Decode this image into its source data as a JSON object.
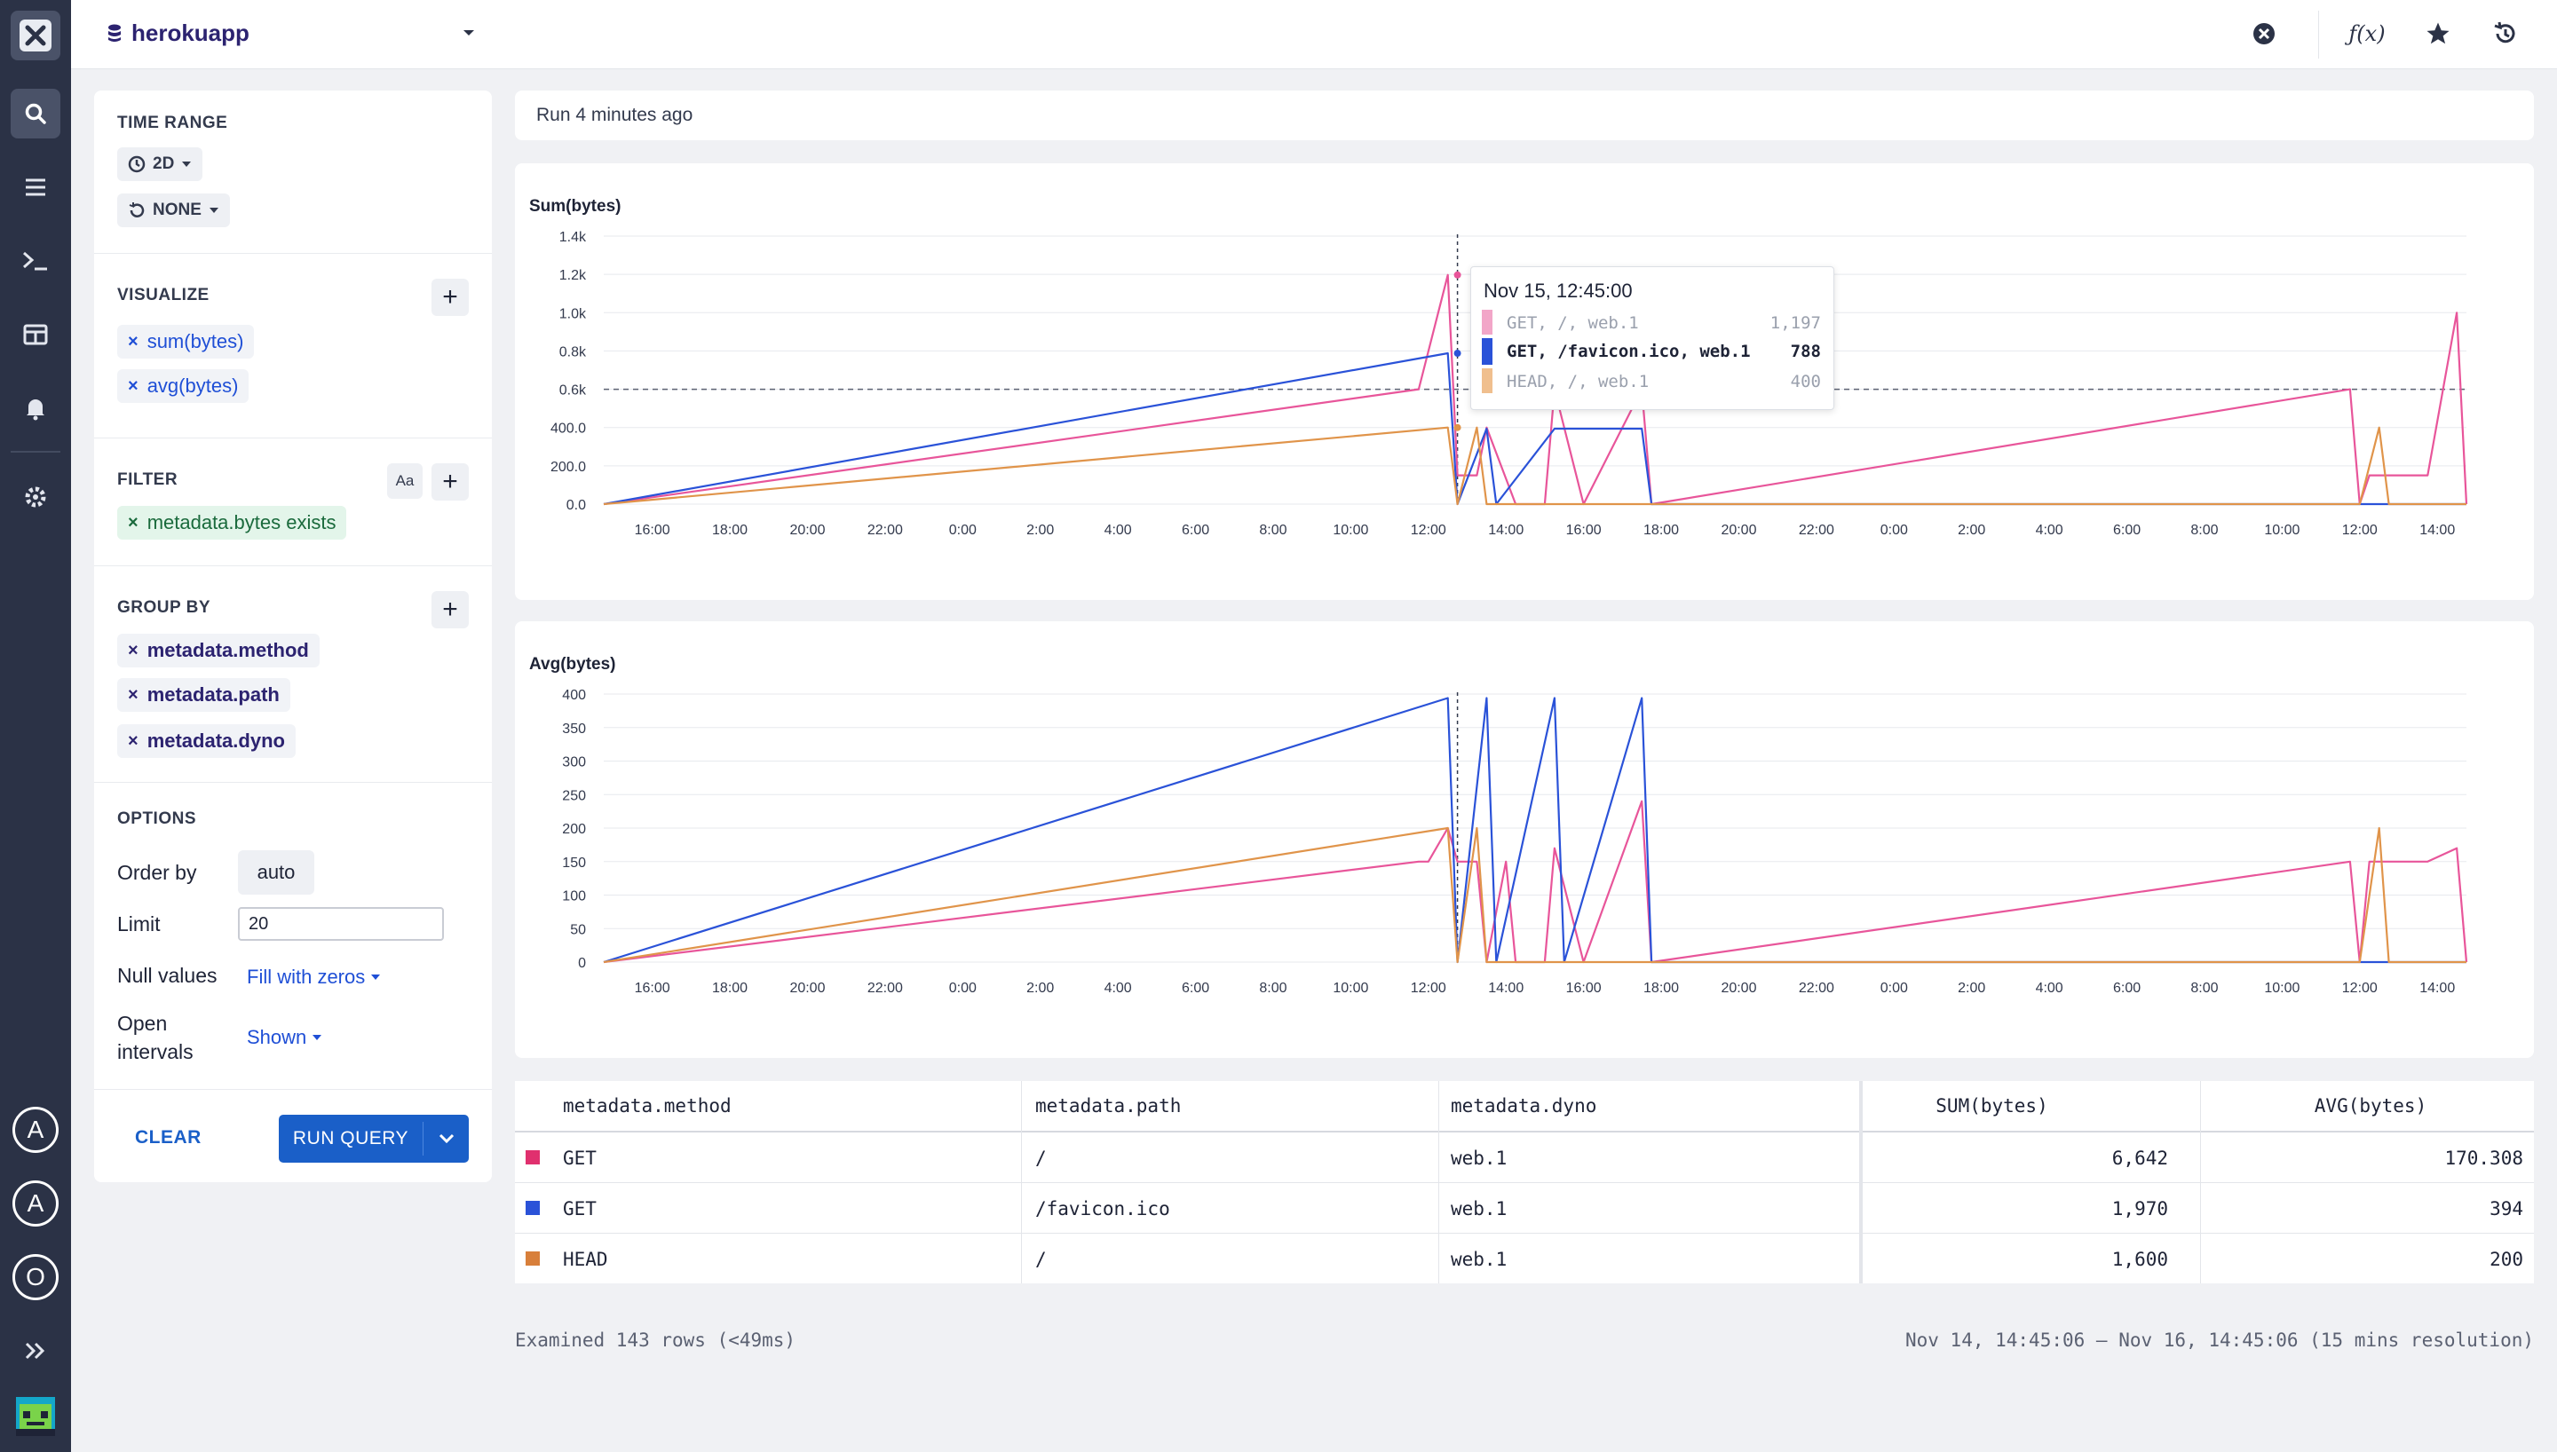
{
  "app": {
    "name": "herokuapp"
  },
  "rail": {
    "avatars": [
      {
        "letter": "A",
        "color": "#e0306e"
      },
      {
        "letter": "A",
        "color": "#3b6ee3"
      },
      {
        "letter": "O",
        "color": "#e0306e"
      }
    ]
  },
  "query": {
    "time_range": {
      "title": "TIME RANGE",
      "range": "2D",
      "compare": "NONE"
    },
    "visualize": {
      "title": "VISUALIZE",
      "items": [
        "sum(bytes)",
        "avg(bytes)"
      ]
    },
    "filter": {
      "title": "FILTER",
      "case_toggle": "Aa",
      "items": [
        "metadata.bytes exists"
      ]
    },
    "group_by": {
      "title": "GROUP BY",
      "items": [
        "metadata.method",
        "metadata.path",
        "metadata.dyno"
      ]
    },
    "options": {
      "title": "OPTIONS",
      "order_by_label": "Order by",
      "order_by_value": "auto",
      "limit_label": "Limit",
      "limit_value": "20",
      "null_values_label": "Null values",
      "null_values_value": "Fill with zeros",
      "open_intervals_label_1": "Open",
      "open_intervals_label_2": "intervals",
      "open_intervals_value": "Shown"
    },
    "clear_label": "CLEAR",
    "run_label": "RUN QUERY"
  },
  "run_status": "Run 4 minutes ago",
  "colors": {
    "get_root": "#e8559a",
    "get_favicon": "#2a52d8",
    "head_root": "#e0944a",
    "accent": "#1a5fc8"
  },
  "chart_data": [
    {
      "type": "line",
      "title": "Sum(bytes)",
      "y_ticks": [
        "0.0",
        "200.0",
        "400.0",
        "0.6k",
        "0.8k",
        "1.0k",
        "1.2k",
        "1.4k"
      ],
      "ylim": [
        0,
        1400
      ],
      "x_ticks": [
        "16:00",
        "18:00",
        "20:00",
        "22:00",
        "0:00",
        "2:00",
        "4:00",
        "6:00",
        "8:00",
        "10:00",
        "12:00",
        "14:00",
        "16:00",
        "18:00",
        "20:00",
        "22:00",
        "0:00",
        "2:00",
        "4:00",
        "6:00",
        "8:00",
        "10:00",
        "12:00",
        "14:00"
      ],
      "xlim_hours": [
        14.75,
        62.75
      ],
      "threshold": 600,
      "hover_hour": 36.75,
      "series": [
        {
          "name": "GET, /, web.1",
          "color": "#e8559a",
          "points": [
            [
              35.75,
              600
            ],
            [
              36.5,
              1197
            ],
            [
              36.75,
              150
            ],
            [
              37.25,
              150
            ],
            [
              37.5,
              400
            ],
            [
              38.25,
              0
            ],
            [
              39,
              0
            ],
            [
              39.25,
              600
            ],
            [
              40,
              0
            ],
            [
              41.5,
              600
            ],
            [
              41.75,
              0
            ],
            [
              59.75,
              600
            ],
            [
              60,
              0
            ],
            [
              60.25,
              150
            ],
            [
              60.75,
              150
            ],
            [
              61.25,
              150
            ],
            [
              61.75,
              150
            ],
            [
              62.5,
              1000
            ],
            [
              62.75,
              0
            ]
          ]
        },
        {
          "name": "GET, /favicon.ico, web.1",
          "color": "#2a52d8",
          "points": [
            [
              36.5,
              788
            ],
            [
              36.75,
              0
            ],
            [
              37.5,
              394
            ],
            [
              37.75,
              0
            ],
            [
              39.25,
              394
            ],
            [
              41.5,
              394
            ],
            [
              41.75,
              0
            ]
          ]
        },
        {
          "name": "HEAD, /, web.1",
          "color": "#e0944a",
          "points": [
            [
              36.5,
              400
            ],
            [
              36.75,
              0
            ],
            [
              37.25,
              400
            ],
            [
              37.5,
              0
            ],
            [
              60,
              0
            ],
            [
              60.5,
              400
            ],
            [
              60.75,
              0
            ]
          ]
        }
      ],
      "tooltip": {
        "title": "Nov 15, 12:45:00",
        "rows": [
          {
            "label": "GET, /, web.1",
            "value": "1,197",
            "color": "#f2a6c8"
          },
          {
            "label": "GET, /favicon.ico, web.1",
            "value": "788",
            "color": "#2a52d8"
          },
          {
            "label": "HEAD, /, web.1",
            "value": "400",
            "color": "#f0bf8e"
          }
        ]
      }
    },
    {
      "type": "line",
      "title": "Avg(bytes)",
      "y_ticks": [
        "0",
        "50",
        "100",
        "150",
        "200",
        "250",
        "300",
        "350",
        "400"
      ],
      "ylim": [
        0,
        400
      ],
      "x_ticks": [
        "16:00",
        "18:00",
        "20:00",
        "22:00",
        "0:00",
        "2:00",
        "4:00",
        "6:00",
        "8:00",
        "10:00",
        "12:00",
        "14:00",
        "16:00",
        "18:00",
        "20:00",
        "22:00",
        "0:00",
        "2:00",
        "4:00",
        "6:00",
        "8:00",
        "10:00",
        "12:00",
        "14:00"
      ],
      "xlim_hours": [
        14.75,
        62.75
      ],
      "hover_hour": 36.75,
      "series": [
        {
          "name": "GET, /, web.1",
          "color": "#e8559a",
          "points": [
            [
              35.75,
              150
            ],
            [
              36,
              150
            ],
            [
              36.5,
              200
            ],
            [
              36.75,
              150
            ],
            [
              37.25,
              150
            ],
            [
              37.5,
              0
            ],
            [
              38,
              150
            ],
            [
              38.25,
              0
            ],
            [
              39,
              0
            ],
            [
              39.25,
              170
            ],
            [
              40,
              0
            ],
            [
              41.5,
              240
            ],
            [
              41.75,
              0
            ],
            [
              59.75,
              150
            ],
            [
              60,
              0
            ],
            [
              60.25,
              150
            ],
            [
              60.75,
              150
            ],
            [
              61.25,
              150
            ],
            [
              61.75,
              150
            ],
            [
              62.5,
              170
            ],
            [
              62.75,
              0
            ]
          ]
        },
        {
          "name": "GET, /favicon.ico, web.1",
          "color": "#2a52d8",
          "points": [
            [
              36.5,
              394
            ],
            [
              36.75,
              0
            ],
            [
              37.5,
              394
            ],
            [
              37.75,
              0
            ],
            [
              39.25,
              394
            ],
            [
              39.5,
              0
            ],
            [
              41.5,
              394
            ],
            [
              41.75,
              0
            ]
          ]
        },
        {
          "name": "HEAD, /, web.1",
          "color": "#e0944a",
          "points": [
            [
              36.5,
              200
            ],
            [
              36.75,
              0
            ],
            [
              37.25,
              200
            ],
            [
              37.5,
              0
            ],
            [
              60,
              0
            ],
            [
              60.5,
              200
            ],
            [
              60.75,
              0
            ]
          ]
        }
      ]
    }
  ],
  "table": {
    "columns": [
      "metadata.method",
      "metadata.path",
      "metadata.dyno",
      "SUM(bytes)",
      "AVG(bytes)"
    ],
    "rows": [
      {
        "color": "#e0306e",
        "cells": [
          "GET",
          "/",
          "web.1",
          "6,642",
          "170.308"
        ]
      },
      {
        "color": "#2a52d8",
        "cells": [
          "GET",
          "/favicon.ico",
          "web.1",
          "1,970",
          "394"
        ]
      },
      {
        "color": "#d87f3a",
        "cells": [
          "HEAD",
          "/",
          "web.1",
          "1,600",
          "200"
        ]
      }
    ]
  },
  "footer": {
    "examined": "Examined 143 rows (<49ms)",
    "range": "Nov 14, 14:45:06 – Nov 16, 14:45:06 (15 mins resolution)"
  }
}
